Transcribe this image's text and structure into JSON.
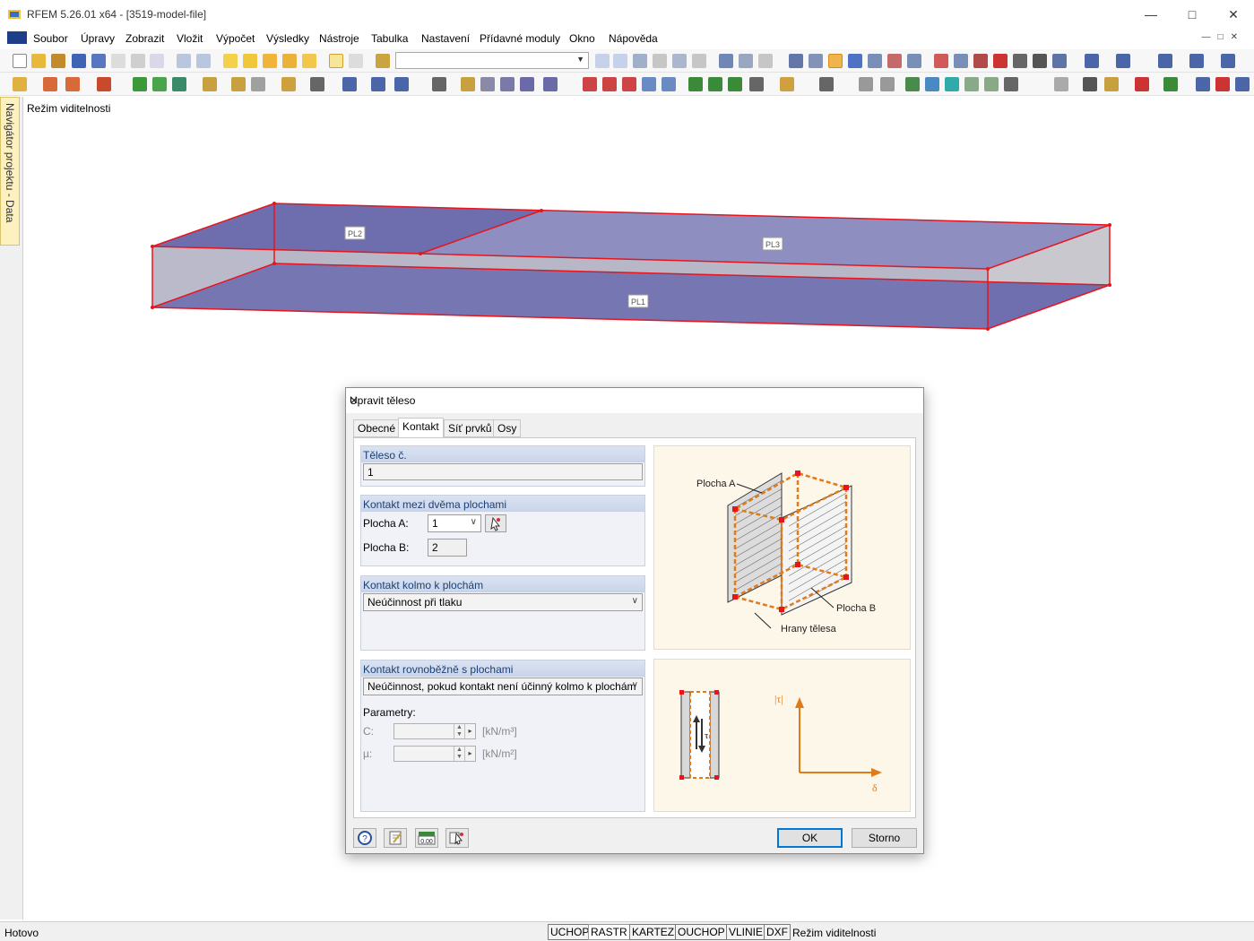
{
  "window": {
    "title": "RFEM 5.26.01 x64 - [3519-model-file]"
  },
  "menu": [
    "Soubor",
    "Úpravy",
    "Zobrazit",
    "Vložit",
    "Výpočet",
    "Výsledky",
    "Nástroje",
    "Tabulka",
    "Nastavení",
    "Přídavné moduly",
    "Okno",
    "Nápověda"
  ],
  "navigator": {
    "label": "Navigátor projektu - Data"
  },
  "canvas": {
    "mode_label": "Režim viditelnosti",
    "surfaces": [
      "PL2",
      "PL3",
      "PL1"
    ]
  },
  "dialog": {
    "title": "Upravit těleso",
    "tabs": [
      "Obecné",
      "Kontakt",
      "Síť prvků",
      "Osy"
    ],
    "active_tab": "Kontakt",
    "body_no": {
      "header": "Těleso č.",
      "value": "1"
    },
    "contact_two": {
      "header": "Kontakt mezi dvěma plochami",
      "surface_a_label": "Plocha A:",
      "surface_a_value": "1",
      "surface_b_label": "Plocha B:",
      "surface_b_value": "2"
    },
    "contact_perp": {
      "header": "Kontakt kolmo k plochám",
      "value": "Neúčinnost při tlaku"
    },
    "contact_parallel": {
      "header": "Kontakt rovnoběžně s plochami",
      "value": "Neúčinnost, pokud kontakt není účinný kolmo k plochám",
      "params_label": "Parametry:",
      "c_label": "C:",
      "c_unit": "[kN/m³]",
      "mu_label": "µ:",
      "mu_unit": "[kN/m²]"
    },
    "illustration": {
      "plocha_a": "Plocha A",
      "plocha_b": "Plocha B",
      "hrany": "Hrany tělesa",
      "tau_axis": "|τ|",
      "delta_axis": "δ",
      "tau": "τ"
    },
    "ok_label": "OK",
    "cancel_label": "Storno"
  },
  "statusbar": {
    "left": "Hotovo",
    "buttons": [
      "UCHOP",
      "RASTR",
      "KARTEZ",
      "OUCHOP",
      "VLINIE",
      "DXF"
    ],
    "pressed": "RASTR",
    "mode": "Režim viditelnosti"
  },
  "colors": {
    "accent": "#0078d7",
    "surface_fill": "#6f6fb0",
    "edge": "#e8141c"
  }
}
